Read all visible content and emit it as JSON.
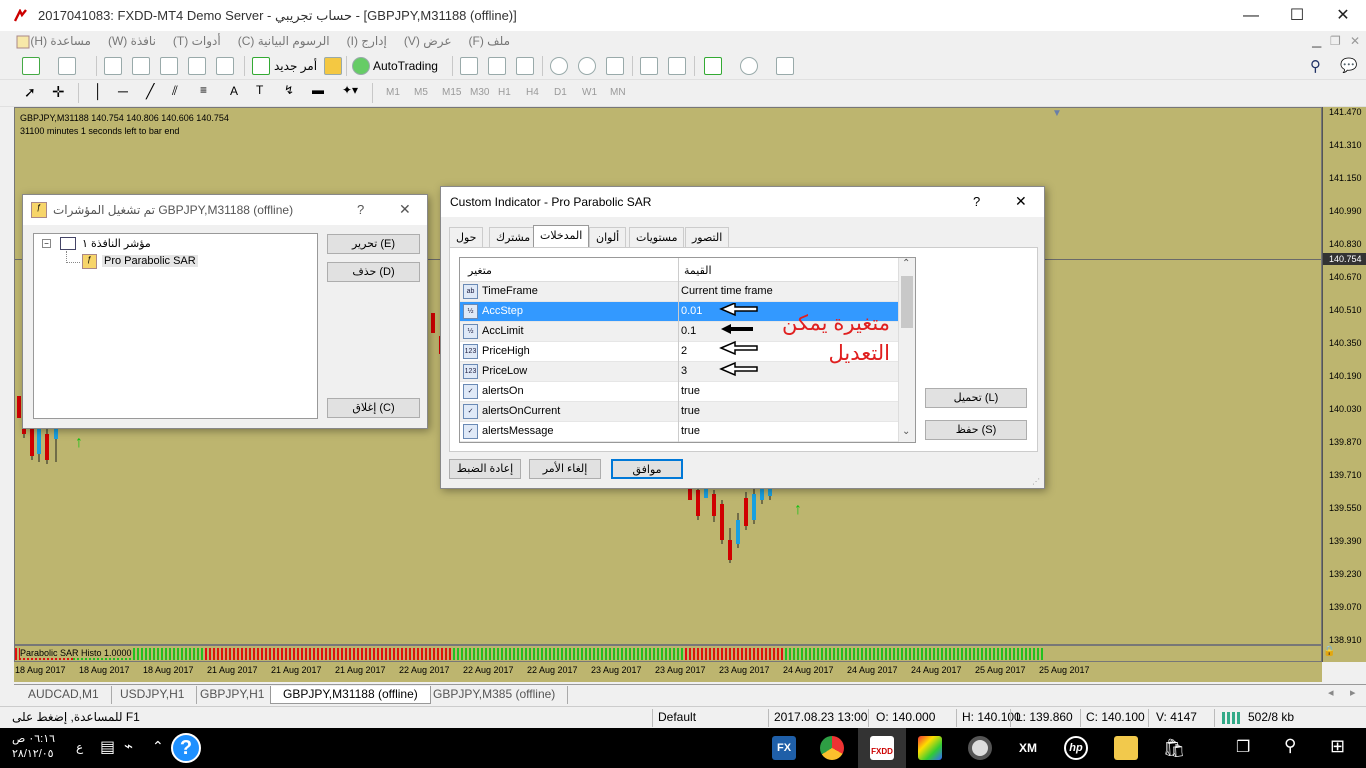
{
  "window": {
    "title": "2017041083: FXDD-MT4 Demo Server - حساب تجريبي - [GBPJPY,M31188 (offline)]",
    "min_glyph": "—",
    "max_glyph": "☐",
    "close_glyph": "✕"
  },
  "menu": [
    "ملف (F)",
    "عرض (V)",
    "إدارج (I)",
    "الرسوم البيانية (C)",
    "أدوات (T)",
    "نافذة (W)",
    "مساعدة (H)"
  ],
  "toolbar": {
    "new_order": "أمر جديد",
    "autotrading": "AutoTrading"
  },
  "timeframes": [
    "M1",
    "M5",
    "M15",
    "M30",
    "H1",
    "H4",
    "D1",
    "W1",
    "MN"
  ],
  "chart": {
    "info_line1": "GBPJPY,M31188  140.754 140.806 140.606 140.754",
    "info_line2": "31100 minutes 1 seconds left to bar end",
    "current_price": "140.754",
    "sub_label": "Parabolic SAR Histo 1.0000",
    "prices": [
      "141.470",
      "141.310",
      "141.150",
      "140.990",
      "140.830",
      "140.670",
      "140.510",
      "140.350",
      "140.190",
      "140.030",
      "139.870",
      "139.710",
      "139.550",
      "139.390",
      "139.230",
      "139.070",
      "138.910"
    ],
    "times": [
      "18 Aug 2017",
      "18 Aug 2017",
      "18 Aug 2017",
      "21 Aug 2017",
      "21 Aug 2017",
      "21 Aug 2017",
      "22 Aug 2017",
      "22 Aug 2017",
      "22 Aug 2017",
      "23 Aug 2017",
      "23 Aug 2017",
      "23 Aug 2017",
      "24 Aug 2017",
      "24 Aug 2017",
      "24 Aug 2017",
      "25 Aug 2017",
      "25 Aug 2017"
    ],
    "histo_colors": {
      "red": "#e01010",
      "green": "#20c020"
    }
  },
  "tabs": [
    "AUDCAD,M1",
    "USDJPY,H1",
    "GBPJPY,H1",
    "GBPJPY,M31188 (offline)",
    "GBPJPY,M385 (offline)"
  ],
  "status": {
    "help": "للمساعدة, إضغط على F1",
    "profile": "Default",
    "datetime": "2017.08.23 13:00",
    "open": "O: 140.000",
    "high": "H: 140.100",
    "low": "L: 139.860",
    "close": "C: 140.100",
    "volume": "V: 4147",
    "traffic": "502/8 kb"
  },
  "taskbar": {
    "time": "٠٦:١٦ ص",
    "date": "٢٨/١٢/٠٥",
    "lang": "ع",
    "fx_label": "FX",
    "fxdd_label": "FXDD",
    "xm_label": "XM"
  },
  "indicators_dialog": {
    "title": "تم تشغيل المؤشرات GBPJPY,M31188 (offline)",
    "help_glyph": "?",
    "close_glyph": "✕",
    "tree_root": "مؤشر النافذة ١",
    "tree_child": "Pro Parabolic SAR",
    "edit_btn": "تحرير (E)",
    "delete_btn": "حذف (D)",
    "close_btn": "إغلاق (C)"
  },
  "custom_dialog": {
    "title": "Custom Indicator - Pro Parabolic SAR",
    "help_glyph": "?",
    "close_glyph": "✕",
    "tabs": [
      "حول",
      "مشترك",
      "المدخلات",
      "ألوان",
      "مستويات",
      "التصور"
    ],
    "col_var": "متغير",
    "col_val": "القيمة",
    "rows": [
      {
        "icon": "ab",
        "name": "TimeFrame",
        "value": "Current time frame"
      },
      {
        "icon": "½",
        "name": "AccStep",
        "value": "0.01"
      },
      {
        "icon": "½",
        "name": "AccLimit",
        "value": "0.1"
      },
      {
        "icon": "123",
        "name": "PriceHigh",
        "value": "2"
      },
      {
        "icon": "123",
        "name": "PriceLow",
        "value": "3"
      },
      {
        "icon": "✓",
        "name": "alertsOn",
        "value": "true"
      },
      {
        "icon": "✓",
        "name": "alertsOnCurrent",
        "value": "true"
      },
      {
        "icon": "✓",
        "name": "alertsMessage",
        "value": "true"
      }
    ],
    "load_btn": "تحميل (L)",
    "save_btn": "حفظ (S)",
    "ok_btn": "موافق",
    "cancel_btn": "إلغاء الأمر",
    "reset_btn": "إعادة الضبط",
    "annotation_line1": "متغيرة يمكن",
    "annotation_line2": "التعديل"
  }
}
